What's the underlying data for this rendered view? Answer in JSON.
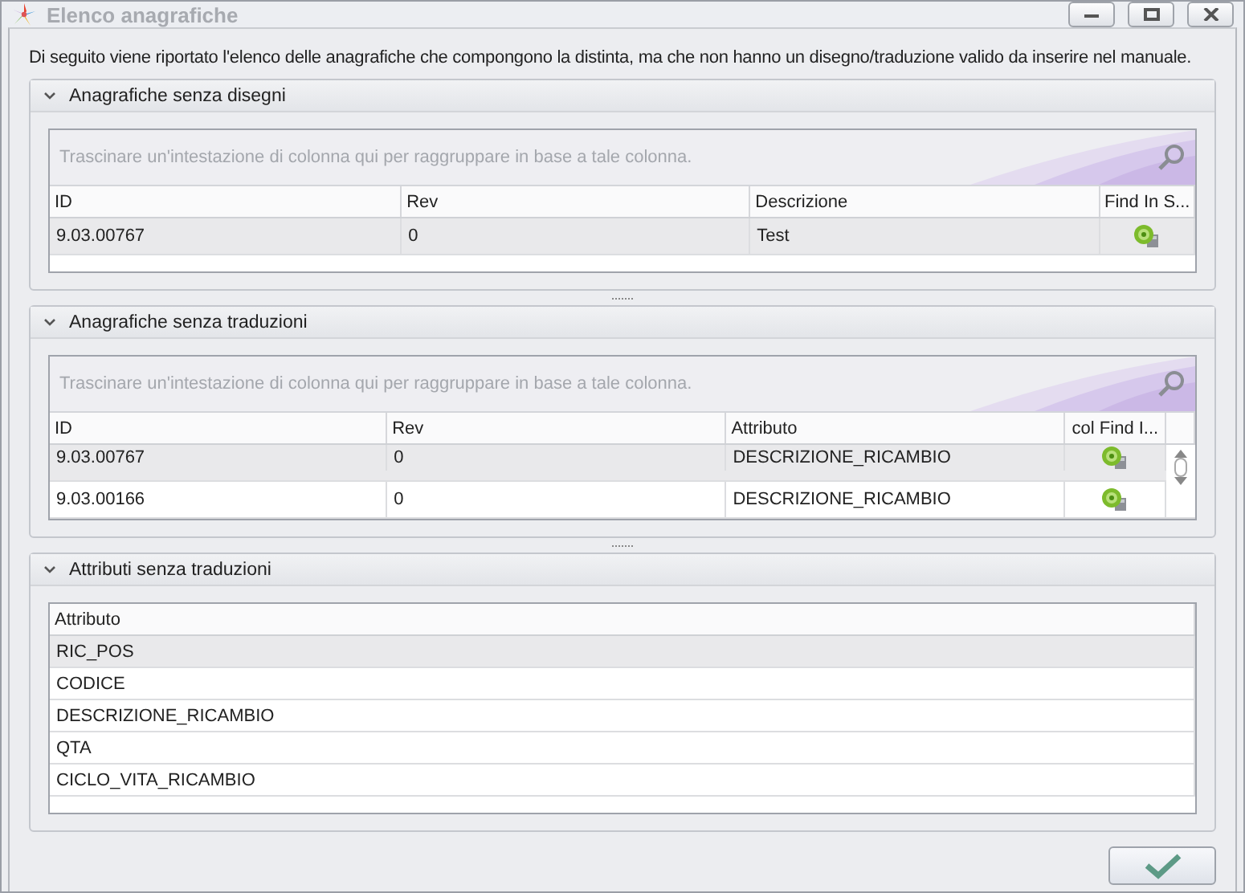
{
  "window": {
    "title": "Elenco anagrafiche",
    "active": false
  },
  "description": "Di seguito viene riportato l'elenco delle anagrafiche che compongono la distinta, ma che non hanno un disegno/traduzione valido da inserire nel manuale.",
  "sections": [
    {
      "title": "Anagrafiche senza disegni",
      "expanded": true,
      "group_hint": "Trascinare un'intestazione di colonna qui per raggruppare in base a tale colonna.",
      "scrollbar": false,
      "columns": [
        {
          "label": "ID",
          "kind": "text"
        },
        {
          "label": "Rev",
          "kind": "text"
        },
        {
          "label": "Descrizione",
          "kind": "text"
        },
        {
          "label": "Find In S...",
          "kind": "action"
        }
      ],
      "rows": [
        {
          "cells": [
            "9.03.00767",
            "0",
            "Test"
          ],
          "selected": true
        }
      ]
    },
    {
      "title": "Anagrafiche senza traduzioni",
      "expanded": true,
      "group_hint": "Trascinare un'intestazione di colonna qui per raggruppare in base a tale colonna.",
      "scrollbar": true,
      "columns": [
        {
          "label": "ID",
          "kind": "text"
        },
        {
          "label": "Rev",
          "kind": "text"
        },
        {
          "label": "Attributo",
          "kind": "text"
        },
        {
          "label": "col Find I...",
          "kind": "action"
        }
      ],
      "rows": [
        {
          "cells": [
            "9.03.00767",
            "0",
            "DESCRIZIONE_RICAMBIO"
          ],
          "selected": true
        },
        {
          "cells": [
            "9.03.00166",
            "0",
            "DESCRIZIONE_RICAMBIO"
          ],
          "selected": false
        }
      ]
    },
    {
      "title": "Attributi senza traduzioni",
      "expanded": true,
      "scrollbar": false,
      "columns": [
        {
          "label": "Attributo",
          "kind": "text"
        }
      ],
      "rows": [
        {
          "cells": [
            "RIC_POS"
          ],
          "selected": true
        },
        {
          "cells": [
            "CODICE"
          ],
          "selected": false
        },
        {
          "cells": [
            "DESCRIZIONE_RICAMBIO"
          ],
          "selected": false
        },
        {
          "cells": [
            "QTA"
          ],
          "selected": false
        },
        {
          "cells": [
            "CICLO_VITA_RICAMBIO"
          ],
          "selected": false
        }
      ]
    }
  ]
}
